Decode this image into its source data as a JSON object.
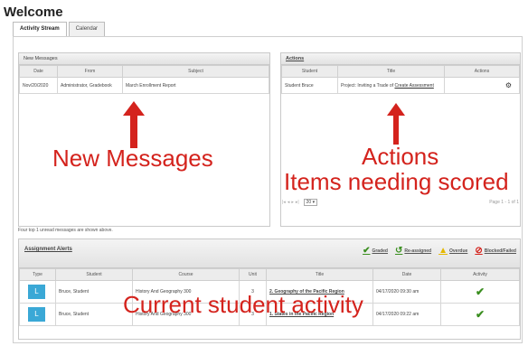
{
  "page": {
    "title": "Welcome"
  },
  "tabs": [
    {
      "label": "Activity Stream"
    },
    {
      "label": "Calendar"
    }
  ],
  "new_messages": {
    "header": "New Messages",
    "columns": [
      "Date",
      "From",
      "Subject"
    ],
    "rows": [
      {
        "date": "Nov/20/2020",
        "from": "Administrator, Gradebook",
        "subject": "March Enrollment Report"
      }
    ],
    "footer": "Four top 1 unread messages are shown above."
  },
  "actions": {
    "header": "Actions",
    "columns": [
      "Student",
      "Title",
      "Actions"
    ],
    "rows": [
      {
        "student": "Student Bruce",
        "title": "Project: Inviting a Trade of",
        "action_link": "Create Assessment"
      }
    ],
    "pager": {
      "prev": "◂",
      "next": "▸",
      "first": "|◂",
      "last": "▸|",
      "page_size": "20 ▾",
      "info": "Page 1 - 1 of 1"
    }
  },
  "assignment_alerts": {
    "header": "Assignment Alerts",
    "legend": [
      {
        "icon": "✔",
        "label": "Graded",
        "color": "#3a8e1f"
      },
      {
        "icon": "↺",
        "label": "Re-assigned",
        "color": "#3a8e1f"
      },
      {
        "icon": "▲",
        "label": "Overdue",
        "color": "#e5b800"
      },
      {
        "icon": "⊘",
        "label": "Blocked/Failed",
        "color": "#d4231d"
      }
    ],
    "columns": [
      "Type",
      "Student",
      "Course",
      "Unit",
      "Title",
      "Date",
      "Activity"
    ],
    "rows": [
      {
        "type": "L",
        "student": "Bruce, Student",
        "course": "History And Geography 300",
        "unit": "3",
        "title": "2. Geography of the Pacific Region",
        "date": "04/17/2020 09:30 am",
        "activity": "✔"
      },
      {
        "type": "L",
        "student": "Bruce, Student",
        "course": "History And Geography 300",
        "unit": "3",
        "title": "1. States in the Pacific Region",
        "date": "04/17/2020 09:22 am",
        "activity": "✔"
      }
    ]
  },
  "annotations": {
    "new_messages": "New Messages",
    "actions_line1": "Actions",
    "actions_line2": "Items needing scored",
    "current_activity": "Current student activity",
    "color": "#d4231d"
  }
}
